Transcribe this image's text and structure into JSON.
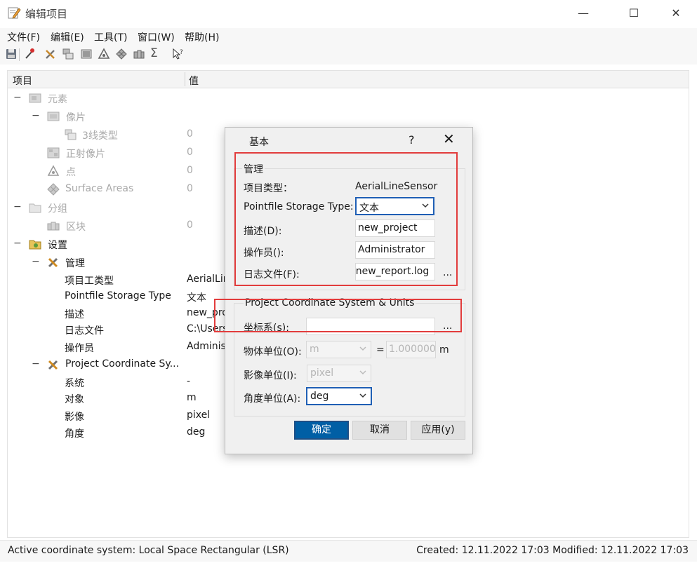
{
  "window": {
    "title": "编辑项目",
    "controls": {
      "minimize": "—",
      "maximize": "☐",
      "close": "✕"
    }
  },
  "menu": [
    "文件(F)",
    "编辑(E)",
    "工具(T)",
    "窗口(W)",
    "帮助(H)"
  ],
  "toolbar_icons": [
    "save-icon",
    "magic-wand-icon",
    "tools-icon",
    "layers-icon",
    "image-icon",
    "triangle-icon",
    "grid-icon",
    "blocks-icon",
    "sigma-icon",
    "help-pointer-icon"
  ],
  "tree": {
    "headers": {
      "item": "项目",
      "value": "值"
    },
    "rows": [
      {
        "label": "元素",
        "value": "",
        "expander": "−"
      },
      {
        "label": "像片",
        "value": "",
        "expander": "−"
      },
      {
        "label": "3线类型",
        "value": "0",
        "expander": ""
      },
      {
        "label": "正射像片",
        "value": "0",
        "expander": ""
      },
      {
        "label": "点",
        "value": "0",
        "expander": ""
      },
      {
        "label": "Surface Areas",
        "value": "0",
        "expander": ""
      },
      {
        "label": "分组",
        "value": "",
        "expander": "−"
      },
      {
        "label": "区块",
        "value": "0",
        "expander": ""
      },
      {
        "label": "设置",
        "value": "",
        "expander": "−"
      },
      {
        "label": "管理",
        "value": "",
        "expander": "−"
      },
      {
        "label": "项目工类型",
        "value": "AerialLineSensor",
        "expander": ""
      },
      {
        "label": "Pointfile Storage Type",
        "value": "文本",
        "expander": ""
      },
      {
        "label": "描述",
        "value": "new_project",
        "expander": ""
      },
      {
        "label": "日志文件",
        "value": "C:\\Users",
        "expander": ""
      },
      {
        "label": "操作员",
        "value": "Administrator",
        "expander": ""
      },
      {
        "label": "Project Coordinate Sy...",
        "value": "",
        "expander": "−"
      },
      {
        "label": "系统",
        "value": "-",
        "expander": ""
      },
      {
        "label": "对象",
        "value": "m",
        "expander": ""
      },
      {
        "label": "影像",
        "value": "pixel",
        "expander": ""
      },
      {
        "label": "角度",
        "value": "deg",
        "expander": ""
      }
    ]
  },
  "status": {
    "left": "Active coordinate system: Local Space Rectangular (LSR)",
    "right": "Created: 12.11.2022 17:03   Modified: 12.11.2022 17:03"
  },
  "dialog": {
    "title": "基本",
    "help": "?",
    "close": "✕",
    "management": {
      "title": "管理",
      "project_type_label": "项目类型：",
      "project_type_value": "AerialLineSensor",
      "storage_label": "Pointfile Storage Type:",
      "storage_value": "文本",
      "desc_label": "描述(D):",
      "desc_value": "new_project",
      "operator_label": "操作员():",
      "operator_value": "Administrator",
      "log_label": "日志文件(F):",
      "log_value": "\\new_report.log",
      "log_browse": "..."
    },
    "coord": {
      "title": "Project Coordinate System & Units",
      "cs_label": "坐标系(s):",
      "cs_value": "",
      "cs_browse": "...",
      "object_unit_label": "物体单位(O):",
      "object_unit_value": "m",
      "eq": "=",
      "factor_value": "1.000000",
      "factor_unit": "m",
      "image_unit_label": "影像单位(I):",
      "image_unit_value": "pixel",
      "angle_unit_label": "角度单位(A):",
      "angle_unit_value": "deg"
    },
    "buttons": {
      "ok": "确定",
      "cancel": "取消",
      "apply": "应用(y)"
    }
  },
  "colors": {
    "accent": "#005fa5",
    "highlight": "#e23c3c",
    "disabled_text": "#a9a9a9"
  }
}
